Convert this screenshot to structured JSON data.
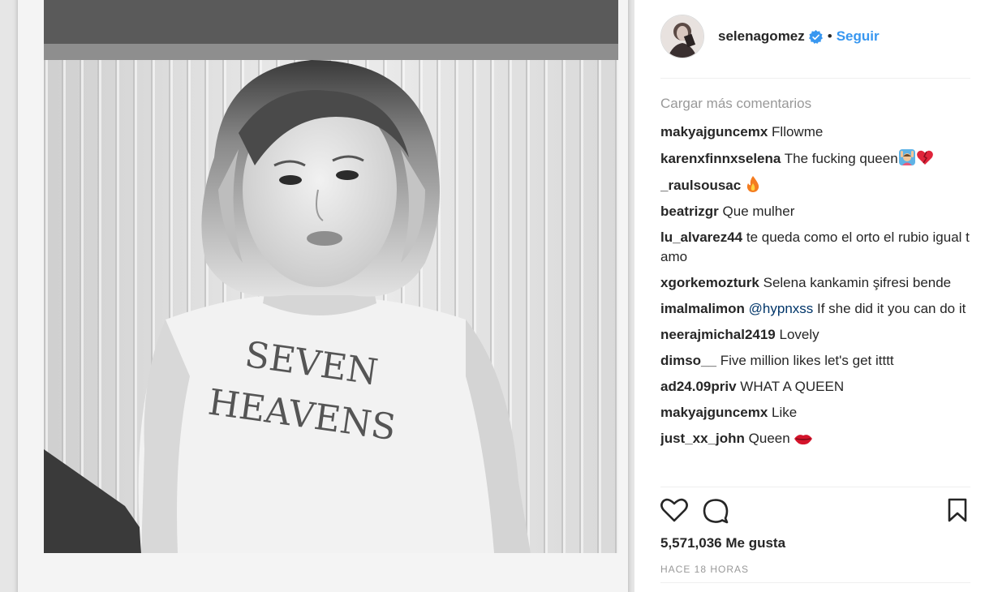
{
  "header": {
    "username": "selenagomez",
    "separator": "•",
    "follow_label": "Seguir",
    "avatar_icon": "user-avatar",
    "verified_icon": "verified-badge-icon"
  },
  "comments": {
    "load_more_label": "Cargar más comentarios",
    "items": [
      {
        "user": "makyajguncemx",
        "text": "Fllowme"
      },
      {
        "user": "karenxfinnxselena",
        "text": "The fucking queen",
        "emojis": [
          "raising-hands-person-icon",
          "heart-icon"
        ]
      },
      {
        "user": "_raulsousac",
        "text": "",
        "emojis": [
          "fire-icon"
        ]
      },
      {
        "user": "beatrizgr",
        "text": "Que mulher"
      },
      {
        "user": "lu_alvarez44",
        "text": "te queda como el orto el rubio igual t amo"
      },
      {
        "user": "xgorkemozturk",
        "text": "Selena kankamin şifresi bende"
      },
      {
        "user": "imalmalimon",
        "mention": "@hypnxss",
        "text": "If she did it you can do it"
      },
      {
        "user": "neerajmichal2419",
        "text": "Lovely"
      },
      {
        "user": "dimso__",
        "text": "Five million likes let's get itttt"
      },
      {
        "user": "ad24.09priv",
        "text": "WHAT A QUEEN"
      },
      {
        "user": "makyajguncemx",
        "text": "Like"
      },
      {
        "user": "just_xx_john",
        "text": "Queen",
        "emojis": [
          "lips-icon"
        ]
      }
    ]
  },
  "actions": {
    "like_icon": "heart-outline-icon",
    "comment_icon": "comment-bubble-icon",
    "save_icon": "bookmark-icon"
  },
  "likes_text": "5,571,036 Me gusta",
  "timestamp": "HACE 18 HORAS",
  "colors": {
    "link_blue": "#3897f0",
    "mention_blue": "#003569",
    "muted_gray": "#999999",
    "text_dark": "#262626"
  },
  "photo": {
    "shirt_text_line1": "SEVEN",
    "shirt_text_line2": "HEAVENS"
  }
}
